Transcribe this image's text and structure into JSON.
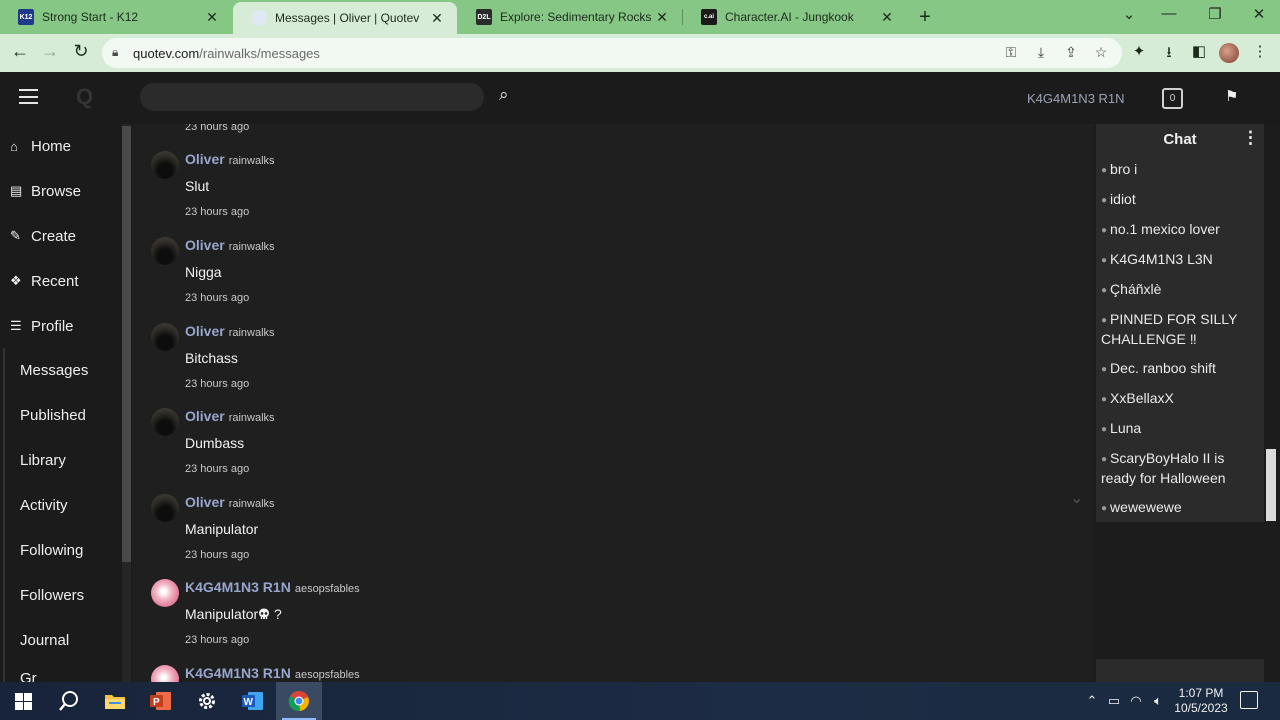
{
  "browser": {
    "tabs": [
      {
        "favicon": "K12",
        "favicon_bg": "#1f3a8a",
        "title": "Strong Start - K12"
      },
      {
        "favicon": "",
        "favicon_bg": "#dfe8f3",
        "title": "Messages | Oliver | Quotev",
        "active": true
      },
      {
        "favicon": "D2L",
        "favicon_bg": "#2b2b2b",
        "title": "Explore: Sedimentary Rocks"
      },
      {
        "favicon": "c.ai",
        "favicon_bg": "#1a1a1a",
        "title": "Character.AI - Jungkook"
      }
    ],
    "url_domain": "quotev.com",
    "url_path": "/rainwalks/messages"
  },
  "header": {
    "username": "K4G4M1N3 R1N",
    "notification_count": "0",
    "search_placeholder": ""
  },
  "sidebar": {
    "primary": [
      {
        "icon": "⌂",
        "icon_name": "home-icon",
        "label": "Home"
      },
      {
        "icon": "▤",
        "icon_name": "browse-icon",
        "label": "Browse"
      },
      {
        "icon": "✎",
        "icon_name": "pencil-icon",
        "label": "Create"
      },
      {
        "icon": "❖",
        "icon_name": "paw-icon",
        "label": "Recent"
      },
      {
        "icon": "☰",
        "icon_name": "profile-list-icon",
        "label": "Profile"
      }
    ],
    "secondary": [
      "Messages",
      "Published",
      "Library",
      "Activity",
      "Following",
      "Followers",
      "Journal",
      "Gr"
    ]
  },
  "messages": {
    "top_time": "23 hours ago",
    "items": [
      {
        "author": "Oliver",
        "handle": "rainwalks",
        "text": "Slut",
        "time": "23 hours ago",
        "avatar": "dark"
      },
      {
        "author": "Oliver",
        "handle": "rainwalks",
        "text": "Nigga",
        "time": "23 hours ago",
        "avatar": "dark"
      },
      {
        "author": "Oliver",
        "handle": "rainwalks",
        "text": "Bitchass",
        "time": "23 hours ago",
        "avatar": "dark"
      },
      {
        "author": "Oliver",
        "handle": "rainwalks",
        "text": "Dumbass",
        "time": "23 hours ago",
        "avatar": "dark"
      },
      {
        "author": "Oliver",
        "handle": "rainwalks",
        "text": "Manipulator",
        "time": "23 hours ago",
        "avatar": "dark"
      },
      {
        "author": "K4G4M1N3 R1N",
        "handle": "aesopsfables",
        "text": "Manipulator",
        "text_suffix": " ?",
        "emoji": "skull",
        "time": "23 hours ago",
        "avatar": "pink"
      },
      {
        "author": "K4G4M1N3 R1N",
        "handle": "aesopsfables",
        "text": "",
        "time": "",
        "avatar": "pink"
      }
    ]
  },
  "chat": {
    "title": "Chat",
    "items": [
      "bro i",
      "idiot",
      "no.1 mexico lover",
      "K4G4M1N3 L3N",
      "Çháñxlè",
      "PINNED FOR SILLY CHALLENGE ‼",
      "Dec. ranboo shift",
      "XxBellaxX",
      "Luna",
      "ScaryBoyHalo II is ready for Halloween",
      "wewewewe"
    ]
  },
  "taskbar": {
    "time": "1:07 PM",
    "date": "10/5/2023"
  },
  "colors": {
    "tab_strip": "#87c785",
    "author_name": "#97a6cc",
    "page_bg": "#1f1f1f"
  }
}
